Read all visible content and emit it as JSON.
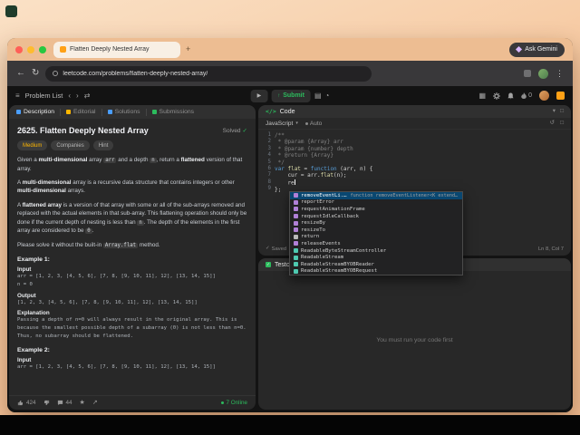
{
  "browser": {
    "tab_title": "Flatten Deeply Nested Array",
    "url": "leetcode.com/problems/flatten-deeply-nested-array/",
    "ask_gemini_label": "Ask Gemini"
  },
  "nav": {
    "problem_list_label": "Problem List",
    "submit_label": "Submit",
    "streak_count": "0"
  },
  "panel_tabs": {
    "description": "Description",
    "editorial": "Editorial",
    "solutions": "Solutions",
    "submissions": "Submissions"
  },
  "problem": {
    "title": "2625. Flatten Deeply Nested Array",
    "solved_label": "Solved",
    "tags": {
      "difficulty": "Medium",
      "companies": "Companies",
      "hint": "Hint"
    },
    "paragraphs": [
      [
        {
          "t": "Given a "
        },
        {
          "t": "multi-dimensional",
          "s": "b"
        },
        {
          "t": " array "
        },
        {
          "t": "arr",
          "s": "c"
        },
        {
          "t": " and a depth "
        },
        {
          "t": "n",
          "s": "c"
        },
        {
          "t": ", return a "
        },
        {
          "t": "flattened",
          "s": "b"
        },
        {
          "t": " version of that array."
        }
      ],
      [
        {
          "t": "A "
        },
        {
          "t": "multi-dimensional",
          "s": "b"
        },
        {
          "t": " array is a recursive data structure that contains integers or other "
        },
        {
          "t": "multi-dimensional",
          "s": "b"
        },
        {
          "t": " arrays."
        }
      ],
      [
        {
          "t": "A "
        },
        {
          "t": "flattened array",
          "s": "b"
        },
        {
          "t": " is a version of that array with some or all of the sub-arrays removed and replaced with the actual elements in that sub-array. This flattening operation should only be done if the current depth of nesting is less than "
        },
        {
          "t": "n",
          "s": "c"
        },
        {
          "t": ". The depth of the elements in the first array are considered to be "
        },
        {
          "t": "0",
          "s": "c"
        },
        {
          "t": "."
        }
      ],
      [
        {
          "t": "Please solve it without the built-in "
        },
        {
          "t": "Array.flat",
          "s": "c"
        },
        {
          "t": " method."
        }
      ]
    ],
    "examples": [
      {
        "label": "Example 1:",
        "input_label": "Input",
        "input_lines": [
          "arr = [1, 2, 3, [4, 5, 6], [7, 8, [9, 10, 11], 12], [13, 14, 15]]",
          "n = 0"
        ],
        "output_label": "Output",
        "output_lines": [
          "[1, 2, 3, [4, 5, 6], [7, 8, [9, 10, 11], 12], [13, 14, 15]]"
        ],
        "explanation_label": "Explanation",
        "explanation": "Passing a depth of n=0 will always result in the original array. This is because the smallest possible depth of a subarray (0) is not less than n=0. Thus, no subarray should be flattened."
      },
      {
        "label": "Example 2:",
        "input_label": "Input",
        "input_lines": [
          "arr = [1, 2, 3, [4, 5, 6], [7, 8, [9, 10, 11], 12], [13, 14, 15]]"
        ]
      }
    ],
    "footer": {
      "likes": "424",
      "comments": "44",
      "online": "7 Online"
    }
  },
  "editor": {
    "panel_title": "Code",
    "language": "JavaScript",
    "autosave_label": "Auto",
    "saved_label": "Saved",
    "cursor_position": "Ln 8, Col 7",
    "lines": [
      {
        "tokens": [
          [
            "/**",
            "c"
          ]
        ]
      },
      {
        "tokens": [
          [
            " * @param {Array} arr",
            "c"
          ]
        ]
      },
      {
        "tokens": [
          [
            " * @param {number} depth",
            "c"
          ]
        ]
      },
      {
        "tokens": [
          [
            " * @return {Array}",
            "c"
          ]
        ]
      },
      {
        "tokens": [
          [
            " */",
            "c"
          ]
        ]
      },
      {
        "tokens": [
          [
            "var",
            "k"
          ],
          [
            " ",
            "p"
          ],
          [
            "flat",
            "f"
          ],
          [
            " = ",
            "p"
          ],
          [
            "function",
            "k"
          ],
          [
            " (arr, n) {",
            "p"
          ]
        ]
      },
      {
        "tokens": [
          [
            "    cur = arr.",
            "p"
          ],
          [
            "flat",
            "f"
          ],
          [
            "(n);",
            "p"
          ]
        ]
      },
      {
        "tokens": [
          [
            "    re",
            "p"
          ]
        ],
        "cursor": true
      },
      {
        "tokens": [
          [
            "};",
            "p"
          ]
        ]
      }
    ],
    "suggestions": [
      {
        "label": "removeEventLi...",
        "kind": "method",
        "detail": "function removeEventListener<K extend...",
        "selected": true
      },
      {
        "label": "reportError",
        "kind": "method"
      },
      {
        "label": "requestAnimationFrame",
        "kind": "method"
      },
      {
        "label": "requestIdleCallback",
        "kind": "method"
      },
      {
        "label": "resizeBy",
        "kind": "method"
      },
      {
        "label": "resizeTo",
        "kind": "method"
      },
      {
        "label": "return",
        "kind": "keyword"
      },
      {
        "label": "releaseEvents",
        "kind": "method"
      },
      {
        "label": "ReadableByteStreamController",
        "kind": "class"
      },
      {
        "label": "ReadableStream",
        "kind": "class"
      },
      {
        "label": "ReadableStreamBYOBReader",
        "kind": "class"
      },
      {
        "label": "ReadableStreamBYOBRequest",
        "kind": "class"
      }
    ]
  },
  "testcase": {
    "panel_title": "Testcase",
    "empty_message": "You must run your code first"
  }
}
